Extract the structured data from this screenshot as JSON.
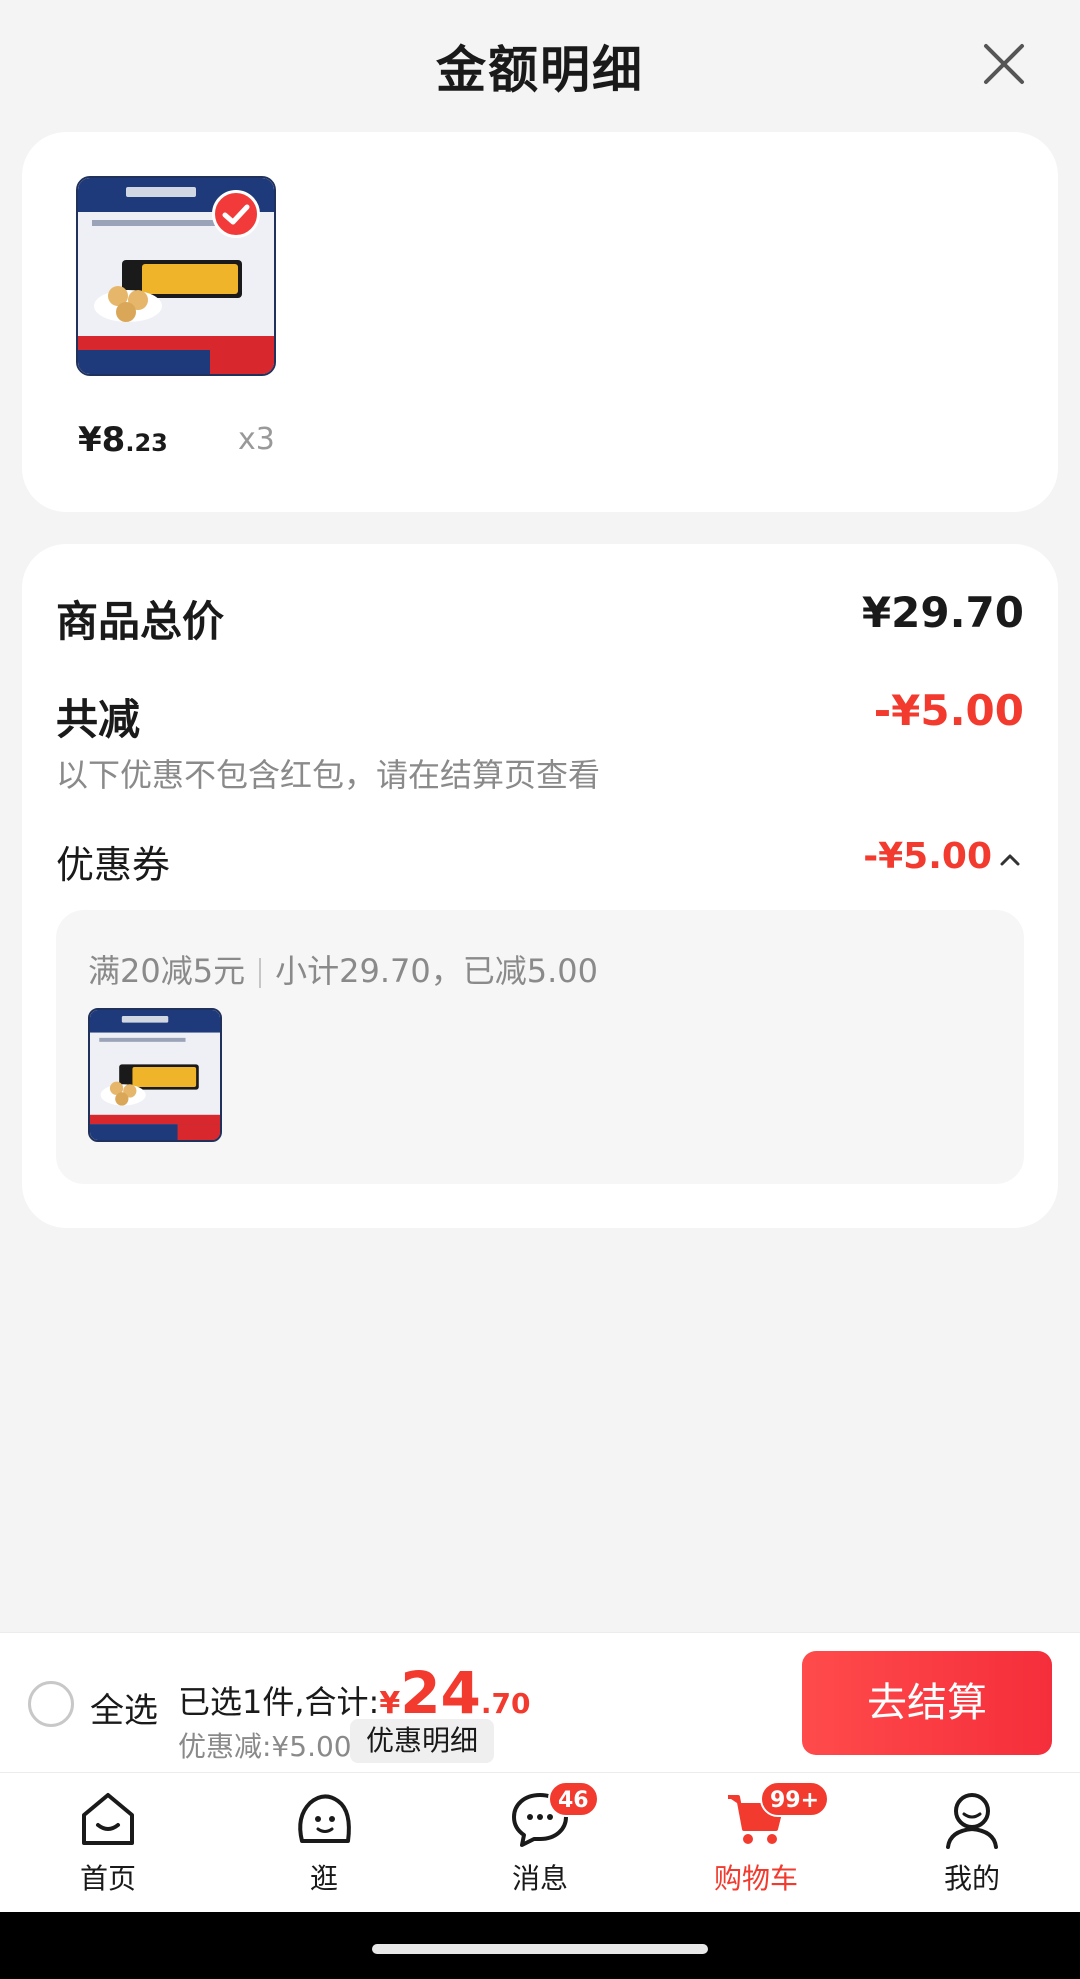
{
  "header": {
    "title": "金额明细",
    "close_icon": "close-icon"
  },
  "product": {
    "price_main": "¥8",
    "price_decimal": ".23",
    "quantity": "x3",
    "selected": true
  },
  "price_details": {
    "total_label": "商品总价",
    "total_value": "¥29.70",
    "reduce_label": "共减",
    "reduce_value": "-¥5.00",
    "note": "以下优惠不包含红包，请在结算页查看",
    "coupon_label": "优惠券",
    "coupon_value": "-¥5.00",
    "coupon_rule": "满20减5元",
    "coupon_summary": "小计29.70，已减5.00"
  },
  "checkout": {
    "select_all": "全选",
    "summary_prefix": "已选1件,合计:",
    "currency": "¥",
    "amount_int": "24",
    "amount_dec": ".70",
    "discount_text": "优惠减:¥5.00",
    "detail_button": "优惠明细",
    "submit_button": "去结算"
  },
  "tabs": [
    {
      "label": "首页",
      "icon": "home-icon"
    },
    {
      "label": "逛",
      "icon": "browse-icon"
    },
    {
      "label": "消息",
      "icon": "message-icon",
      "badge": "46"
    },
    {
      "label": "购物车",
      "icon": "cart-icon",
      "badge": "99+",
      "active": true
    },
    {
      "label": "我的",
      "icon": "profile-icon"
    }
  ],
  "colors": {
    "accent": "#f23a2e",
    "background": "#f4f4f4"
  }
}
